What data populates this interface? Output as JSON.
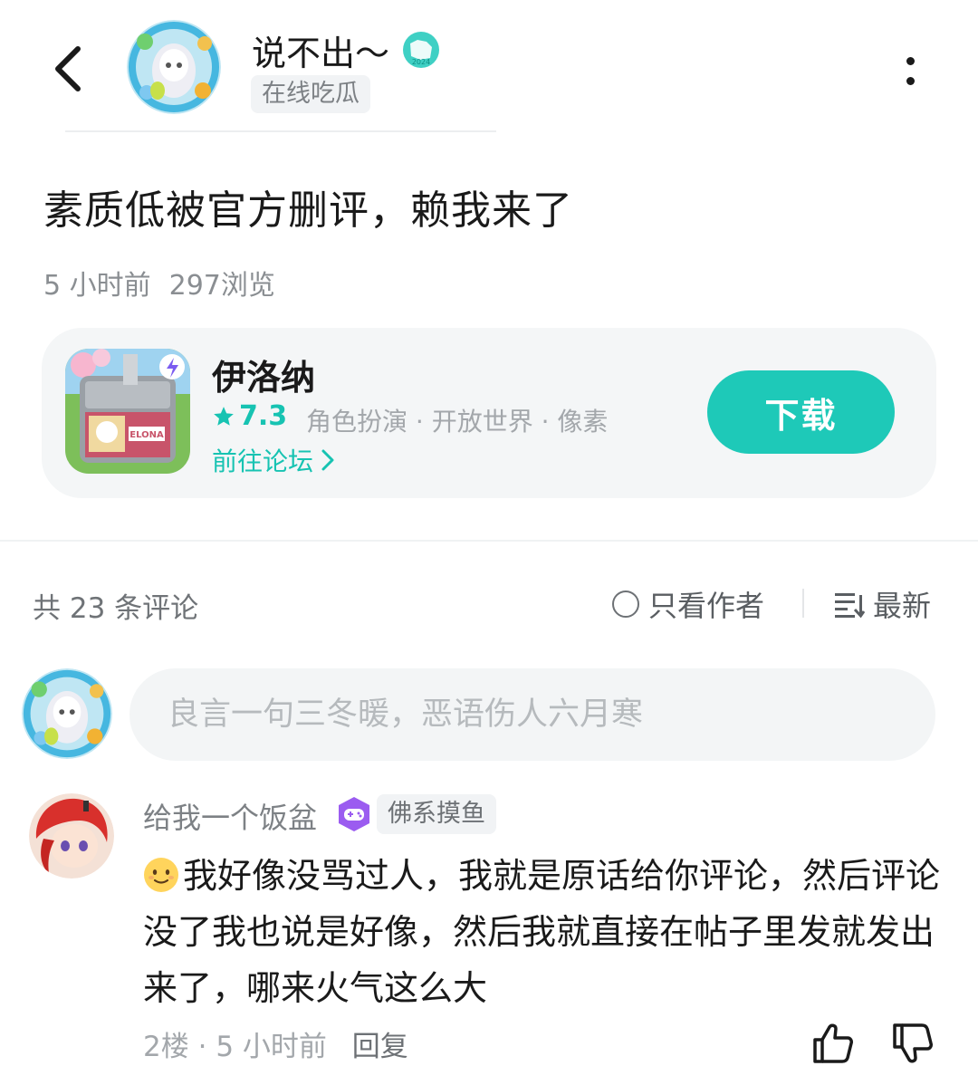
{
  "header": {
    "author_name": "说不出～",
    "author_tag": "在线吃瓜",
    "year_badge": "2024",
    "back_icon": "chevron-left-icon",
    "more_icon": "more-vertical-icon"
  },
  "post": {
    "title": "素质低被官方删评，赖我来了",
    "time": "5 小时前",
    "views": "297浏览"
  },
  "game": {
    "name": "伊洛纳",
    "rating": "7.3",
    "tags": "角色扮演 · 开放世界 · 像素",
    "forum_link": "前往论坛",
    "download": "下载",
    "icon_label": "ELONA",
    "accent": "#1ec9b8"
  },
  "comments_bar": {
    "count": "共 23 条评论",
    "author_only": "只看作者",
    "sort": "最新"
  },
  "comment_input": {
    "placeholder": "良言一句三冬暖，恶语伤人六月寒"
  },
  "comment": {
    "user": "给我一个饭盆",
    "tag": "佛系摸鱼",
    "text": "我好像没骂过人，我就是原话给你评论，然后评论没了我也说是好像，然后我就直接在帖子里发就发出来了，哪来火气这么大",
    "floor": "2楼",
    "time": "5 小时前",
    "reply": "回复"
  }
}
